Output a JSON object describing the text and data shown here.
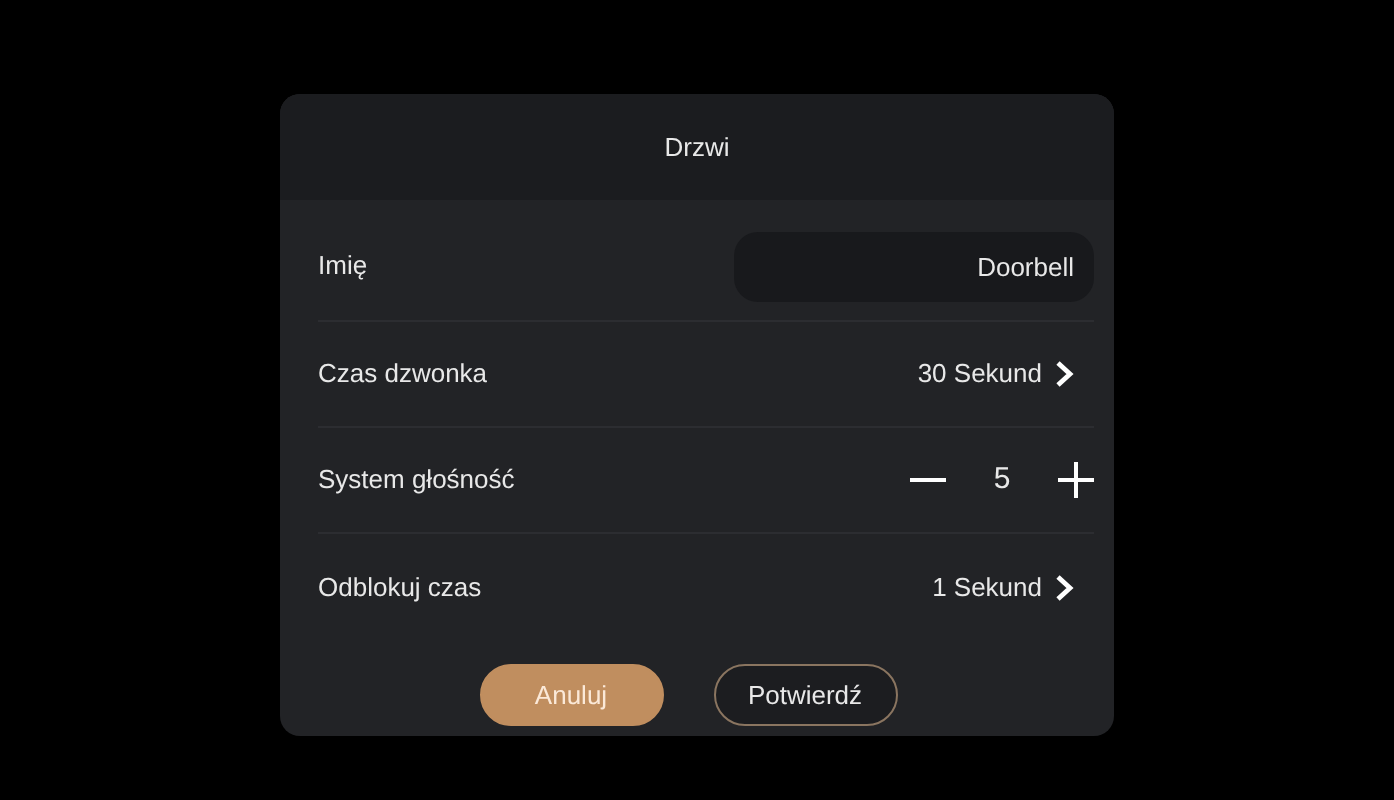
{
  "dialog": {
    "title": "Drzwi",
    "rows": [
      {
        "kind": "field",
        "label": "Imię",
        "value": "Doorbell"
      },
      {
        "kind": "select",
        "label": "Czas dzwonka",
        "value": "30 Sekund"
      },
      {
        "kind": "stepper",
        "label": "System głośność",
        "value": "5"
      },
      {
        "kind": "select",
        "label": "Odblokuj czas",
        "value": "1 Sekund"
      }
    ],
    "buttons": [
      {
        "kind": "primary",
        "label": "Anuluj"
      },
      {
        "kind": "outline",
        "label": "Potwierdź"
      }
    ]
  }
}
